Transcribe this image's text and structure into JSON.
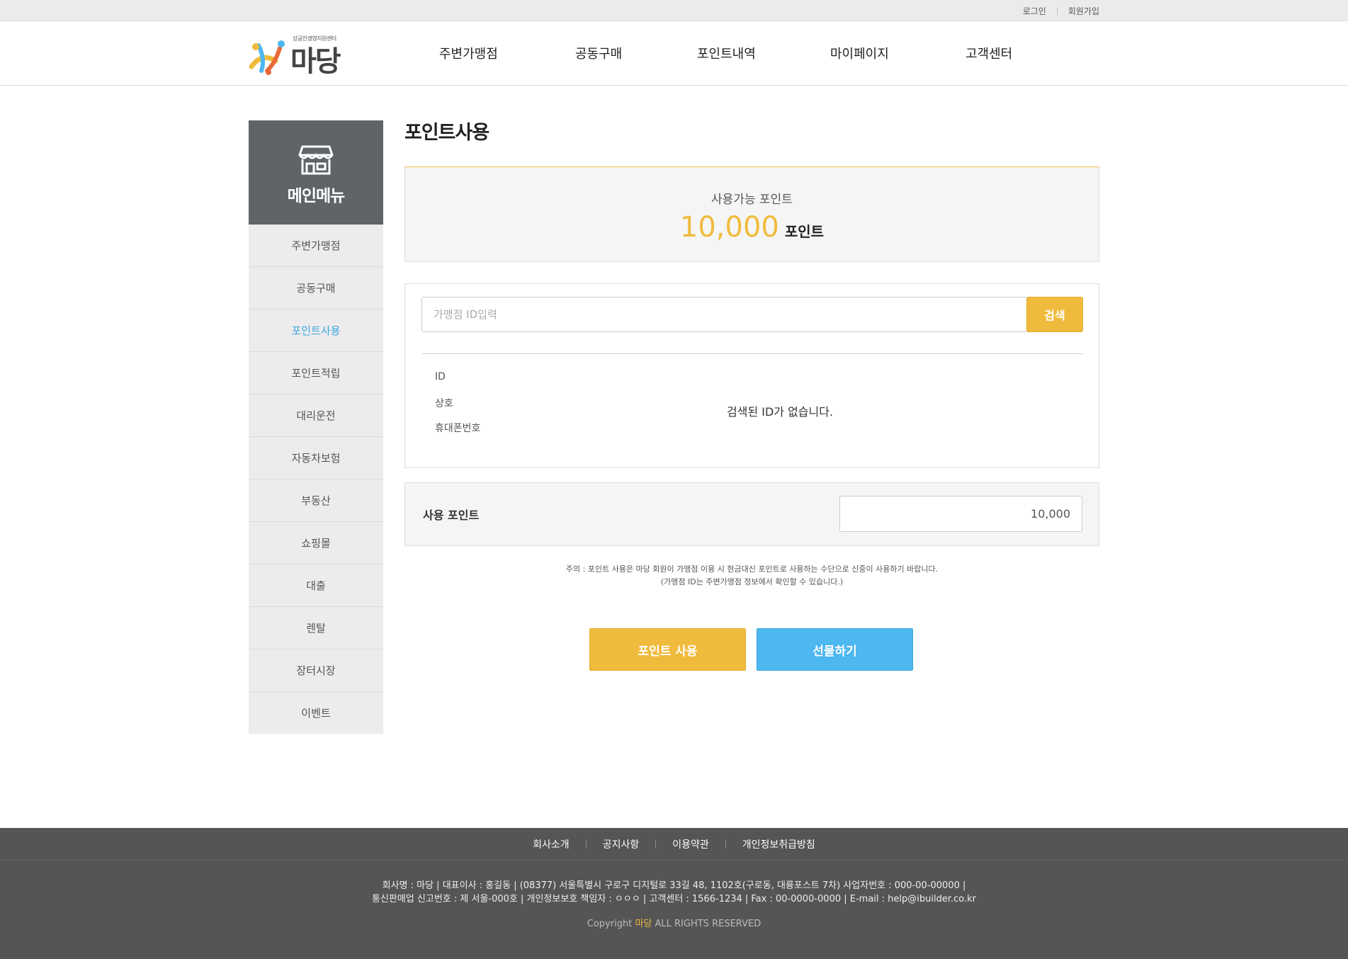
{
  "topbar": {
    "login": "로그인",
    "signup": "회원가입"
  },
  "logo": {
    "tagline": "상공인경영지원센터",
    "name": "마당"
  },
  "gnb": [
    "주변가맹점",
    "공동구매",
    "포인트내역",
    "마이페이지",
    "고객센터"
  ],
  "sidebar": {
    "title": "메인메뉴",
    "icon": "store-icon",
    "items": [
      "주변가맹점",
      "공동구매",
      "포인트사용",
      "포인트적립",
      "대리운전",
      "자동차보험",
      "부동산",
      "쇼핑몰",
      "대출",
      "렌탈",
      "장터시장",
      "이벤트"
    ],
    "active_index": 2
  },
  "main": {
    "title": "포인트사용",
    "available": {
      "label": "사용가능 포인트",
      "amount": "10,000",
      "unit": "포인트"
    },
    "search": {
      "placeholder": "가맹점 ID입력",
      "button": "검색",
      "fields": [
        "ID",
        "상호",
        "휴대폰번호"
      ],
      "no_result": "검색된 ID가 없습니다."
    },
    "use": {
      "label": "사용 포인트",
      "value": "10,000"
    },
    "notice": [
      "주의 : 포인트 사용은 마당 회원이 가맹점 이용 시 현금대신 포인트로 사용하는 수단으로 신중이 사용하기 바랍니다.",
      "(가맹점 ID는 주변가맹점 정보에서 확인할 수 있습니다.)"
    ],
    "buttons": {
      "use": "포인트 사용",
      "gift": "선물하기"
    }
  },
  "footer": {
    "nav": [
      "회사소개",
      "공지사항",
      "이용약관",
      "개인정보취급방침"
    ],
    "info": [
      "회사명 : 마당 | 대표이사 : 홍길동 | (08377) 서울특별시 구로구 디지털로 33길 48, 1102호(구로동, 대륭포스트 7차) 사업자번호 : 000-00-00000 |",
      "통신판매업 신고번호 : 제 서울-000호 | 개인정보보호 책임자 : ㅇㅇㅇ | 고객센터 : 1566-1234 | Fax : 00-0000-0000 | E-mail : help@ibuilder.co.kr"
    ],
    "copyright": {
      "prefix": "Copyright",
      "brand": "마당",
      "suffix": "ALL RIGHTS RESERVED"
    }
  },
  "colors": {
    "accent": "#f0bb3d",
    "blue": "#4db7f0",
    "active": "#3aa4e0",
    "sidebar_head": "#5e6467",
    "footer": "#555555"
  }
}
